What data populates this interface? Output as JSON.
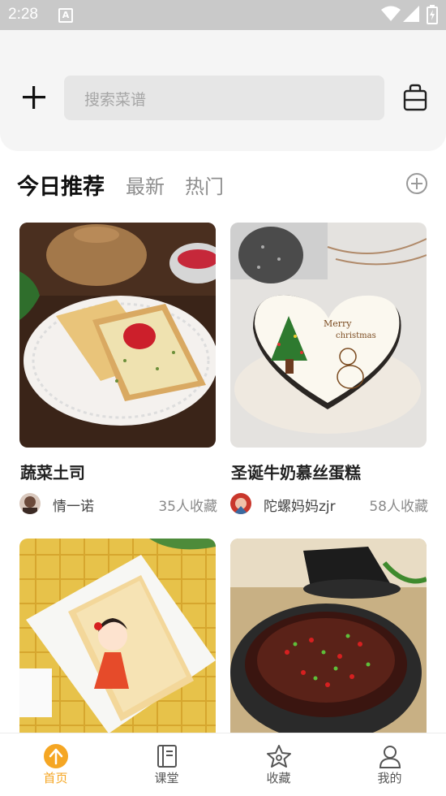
{
  "status_bar": {
    "time": "2:28",
    "notification_icon": "A"
  },
  "header": {
    "search_placeholder": "搜索菜谱"
  },
  "tabs": [
    {
      "label": "今日推荐",
      "active": true
    },
    {
      "label": "最新",
      "active": false
    },
    {
      "label": "热门",
      "active": false
    }
  ],
  "cards": [
    {
      "title": "蔬菜土司",
      "author": "情一诺",
      "favorites": "35人收藏"
    },
    {
      "title": "圣诞牛奶慕丝蛋糕",
      "author": "陀螺妈妈zjr",
      "favorites": "58人收藏"
    },
    {
      "title": "",
      "author": "",
      "favorites": ""
    },
    {
      "title": "",
      "author": "",
      "favorites": ""
    }
  ],
  "bottom_nav": [
    {
      "label": "首页",
      "icon": "home-arrow-icon",
      "active": true
    },
    {
      "label": "课堂",
      "icon": "book-icon",
      "active": false
    },
    {
      "label": "收藏",
      "icon": "star-icon",
      "active": false
    },
    {
      "label": "我的",
      "icon": "user-icon",
      "active": false
    }
  ],
  "colors": {
    "accent": "#f5a623",
    "header_bg": "#f5f5f5",
    "status_bg": "#c9c9c9"
  }
}
